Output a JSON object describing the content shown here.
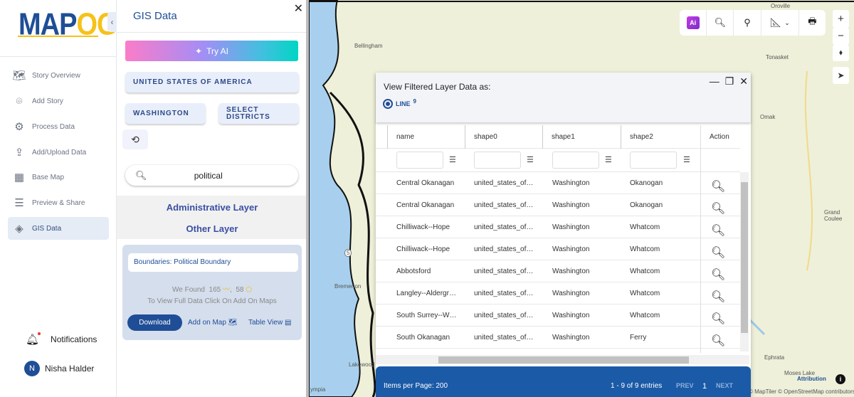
{
  "logo": {
    "part1": "MAP",
    "part2": "OG"
  },
  "sidebar": {
    "items": [
      {
        "label": "Story Overview",
        "icon": "map-icon"
      },
      {
        "label": "Add Story",
        "icon": "location-pin-icon"
      },
      {
        "label": "Process Data",
        "icon": "process-data-icon"
      },
      {
        "label": "Add/Upload Data",
        "icon": "upload-file-icon"
      },
      {
        "label": "Base Map",
        "icon": "base-map-icon"
      },
      {
        "label": "Preview & Share",
        "icon": "preview-icon"
      },
      {
        "label": "GIS Data",
        "icon": "gis-data-icon"
      }
    ],
    "notifications": "Notifications",
    "user": {
      "initial": "N",
      "name": "Nisha Halder"
    }
  },
  "panel": {
    "title": "GIS Data",
    "try_ai": "Try AI",
    "country": "UNITED STATES OF AMERICA",
    "state": "WASHINGTON",
    "districts": "SELECT DISTRICTS",
    "search_value": "political",
    "admin_layer": "Administrative Layer",
    "other_layer": "Other Layer",
    "card": {
      "title": "Boundaries: Political Boundary",
      "found_label": "We Found",
      "line_count": "165",
      "poly_count": "58",
      "hint": "To View Full Data Click On Add On Maps",
      "download": "Download",
      "add_on_map": "Add on Map",
      "table_view": "Table View"
    }
  },
  "map": {
    "labels": [
      "Bellingham",
      "Tonasket",
      "Omak",
      "Grand Coulee",
      "Bremerton",
      "Ephrata",
      "Moses Lake",
      "Lakewood",
      "ympia",
      "Oroville"
    ],
    "attribution": "Attribution",
    "copyright": "© MapTiler © OpenStreetMap contributors",
    "route": "5"
  },
  "modal": {
    "title": "View Filtered Layer Data as:",
    "option": "LINE",
    "option_count": "9",
    "columns": [
      "name",
      "shape0",
      "shape1",
      "shape2",
      "Action"
    ],
    "rows": [
      [
        "Central Okanagan",
        "united_states_of_america",
        "Washington",
        "Okanogan"
      ],
      [
        "Central Okanagan",
        "united_states_of_america",
        "Washington",
        "Okanogan"
      ],
      [
        "Chilliwack--Hope",
        "united_states_of_america",
        "Washington",
        "Whatcom"
      ],
      [
        "Chilliwack--Hope",
        "united_states_of_america",
        "Washington",
        "Whatcom"
      ],
      [
        "Abbotsford",
        "united_states_of_america",
        "Washington",
        "Whatcom"
      ],
      [
        "Langley--Aldergrove",
        "united_states_of_america",
        "Washington",
        "Whatcom"
      ],
      [
        "South Surrey--White Rock",
        "united_states_of_america",
        "Washington",
        "Whatcom"
      ],
      [
        "South Okanagan",
        "united_states_of_america",
        "Washington",
        "Ferry"
      ]
    ],
    "footer": {
      "items_per_page": "Items per Page: 200",
      "entries": "1 - 9 of 9 entries",
      "prev": "PREV",
      "page": "1",
      "next": "NEXT"
    }
  },
  "colors": {
    "brand": "#1f4e97",
    "accent": "#f5c21b",
    "footer": "#1b5aa7"
  }
}
